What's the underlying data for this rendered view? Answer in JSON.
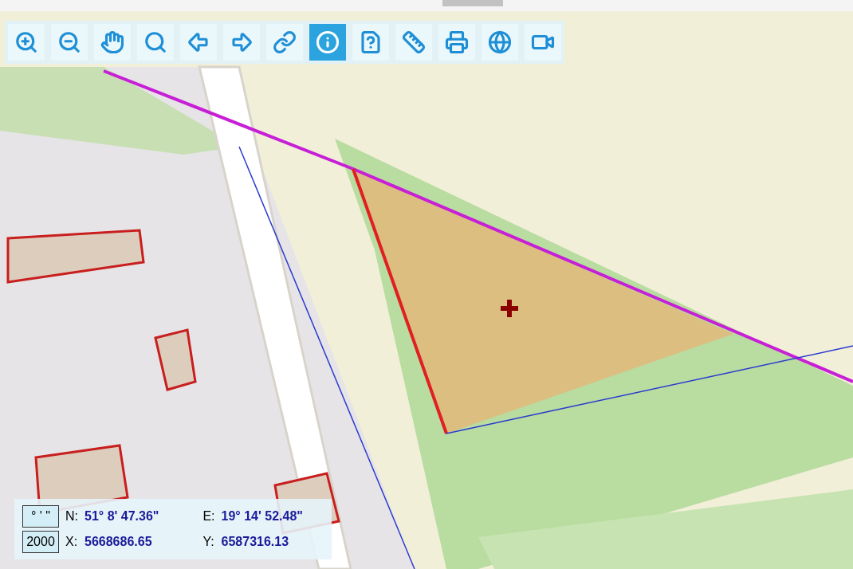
{
  "toolbar": {
    "buttons": [
      {
        "kind": "zoom-in",
        "selected": false
      },
      {
        "kind": "zoom-out",
        "selected": false
      },
      {
        "kind": "pan",
        "selected": false
      },
      {
        "kind": "zoom-area",
        "selected": false
      },
      {
        "kind": "back",
        "selected": false
      },
      {
        "kind": "forward",
        "selected": false
      },
      {
        "kind": "link",
        "selected": false
      },
      {
        "kind": "info",
        "selected": true
      },
      {
        "kind": "info-layer",
        "selected": false
      },
      {
        "kind": "measure",
        "selected": false
      },
      {
        "kind": "print",
        "selected": false
      },
      {
        "kind": "globe",
        "selected": false
      },
      {
        "kind": "video",
        "selected": false
      }
    ]
  },
  "coordinates": {
    "format_button": "° ' \"",
    "scale_button": "2000",
    "readouts": [
      {
        "label": "N:",
        "value": "51° 8' 47.36\""
      },
      {
        "label": "E:",
        "value": "19° 14' 52.48\""
      },
      {
        "label": "X:",
        "value": "5668686.65"
      },
      {
        "label": "Y:",
        "value": "6587316.13"
      }
    ]
  }
}
